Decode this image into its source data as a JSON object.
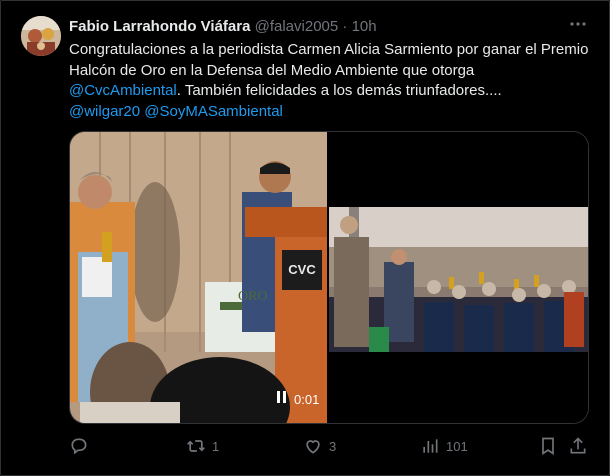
{
  "tweet": {
    "author_name": "Fabio Larrahondo Viáfara",
    "handle": "@falavi2005",
    "separator": "·",
    "time": "10h",
    "text_part1": "Congratulaciones a la periodista Carmen Alicia Sarmiento por ganar el Premio Halcón de Oro en la Defensa del Medio Ambiente que otorga ",
    "mention1": "@CvcAmbiental",
    "text_part2": ". También felicidades a los demás triunfadores....",
    "mention2": "@wilgar20",
    "mention3": "@SoyMASambiental"
  },
  "media": {
    "podium_sign": "CVC",
    "banner_text": "ORO",
    "video_time": "0:01"
  },
  "actions": {
    "replies": "",
    "retweets": "1",
    "likes": "3",
    "views": "101"
  },
  "colors": {
    "background": "#000000",
    "text": "#e7e9ea",
    "muted": "#71767b",
    "link": "#1d9bf0",
    "border": "#2f3336"
  },
  "icons": [
    "reply-icon",
    "retweet-icon",
    "like-icon",
    "views-icon",
    "bookmark-icon",
    "share-icon",
    "more-icon",
    "pause-icon"
  ]
}
